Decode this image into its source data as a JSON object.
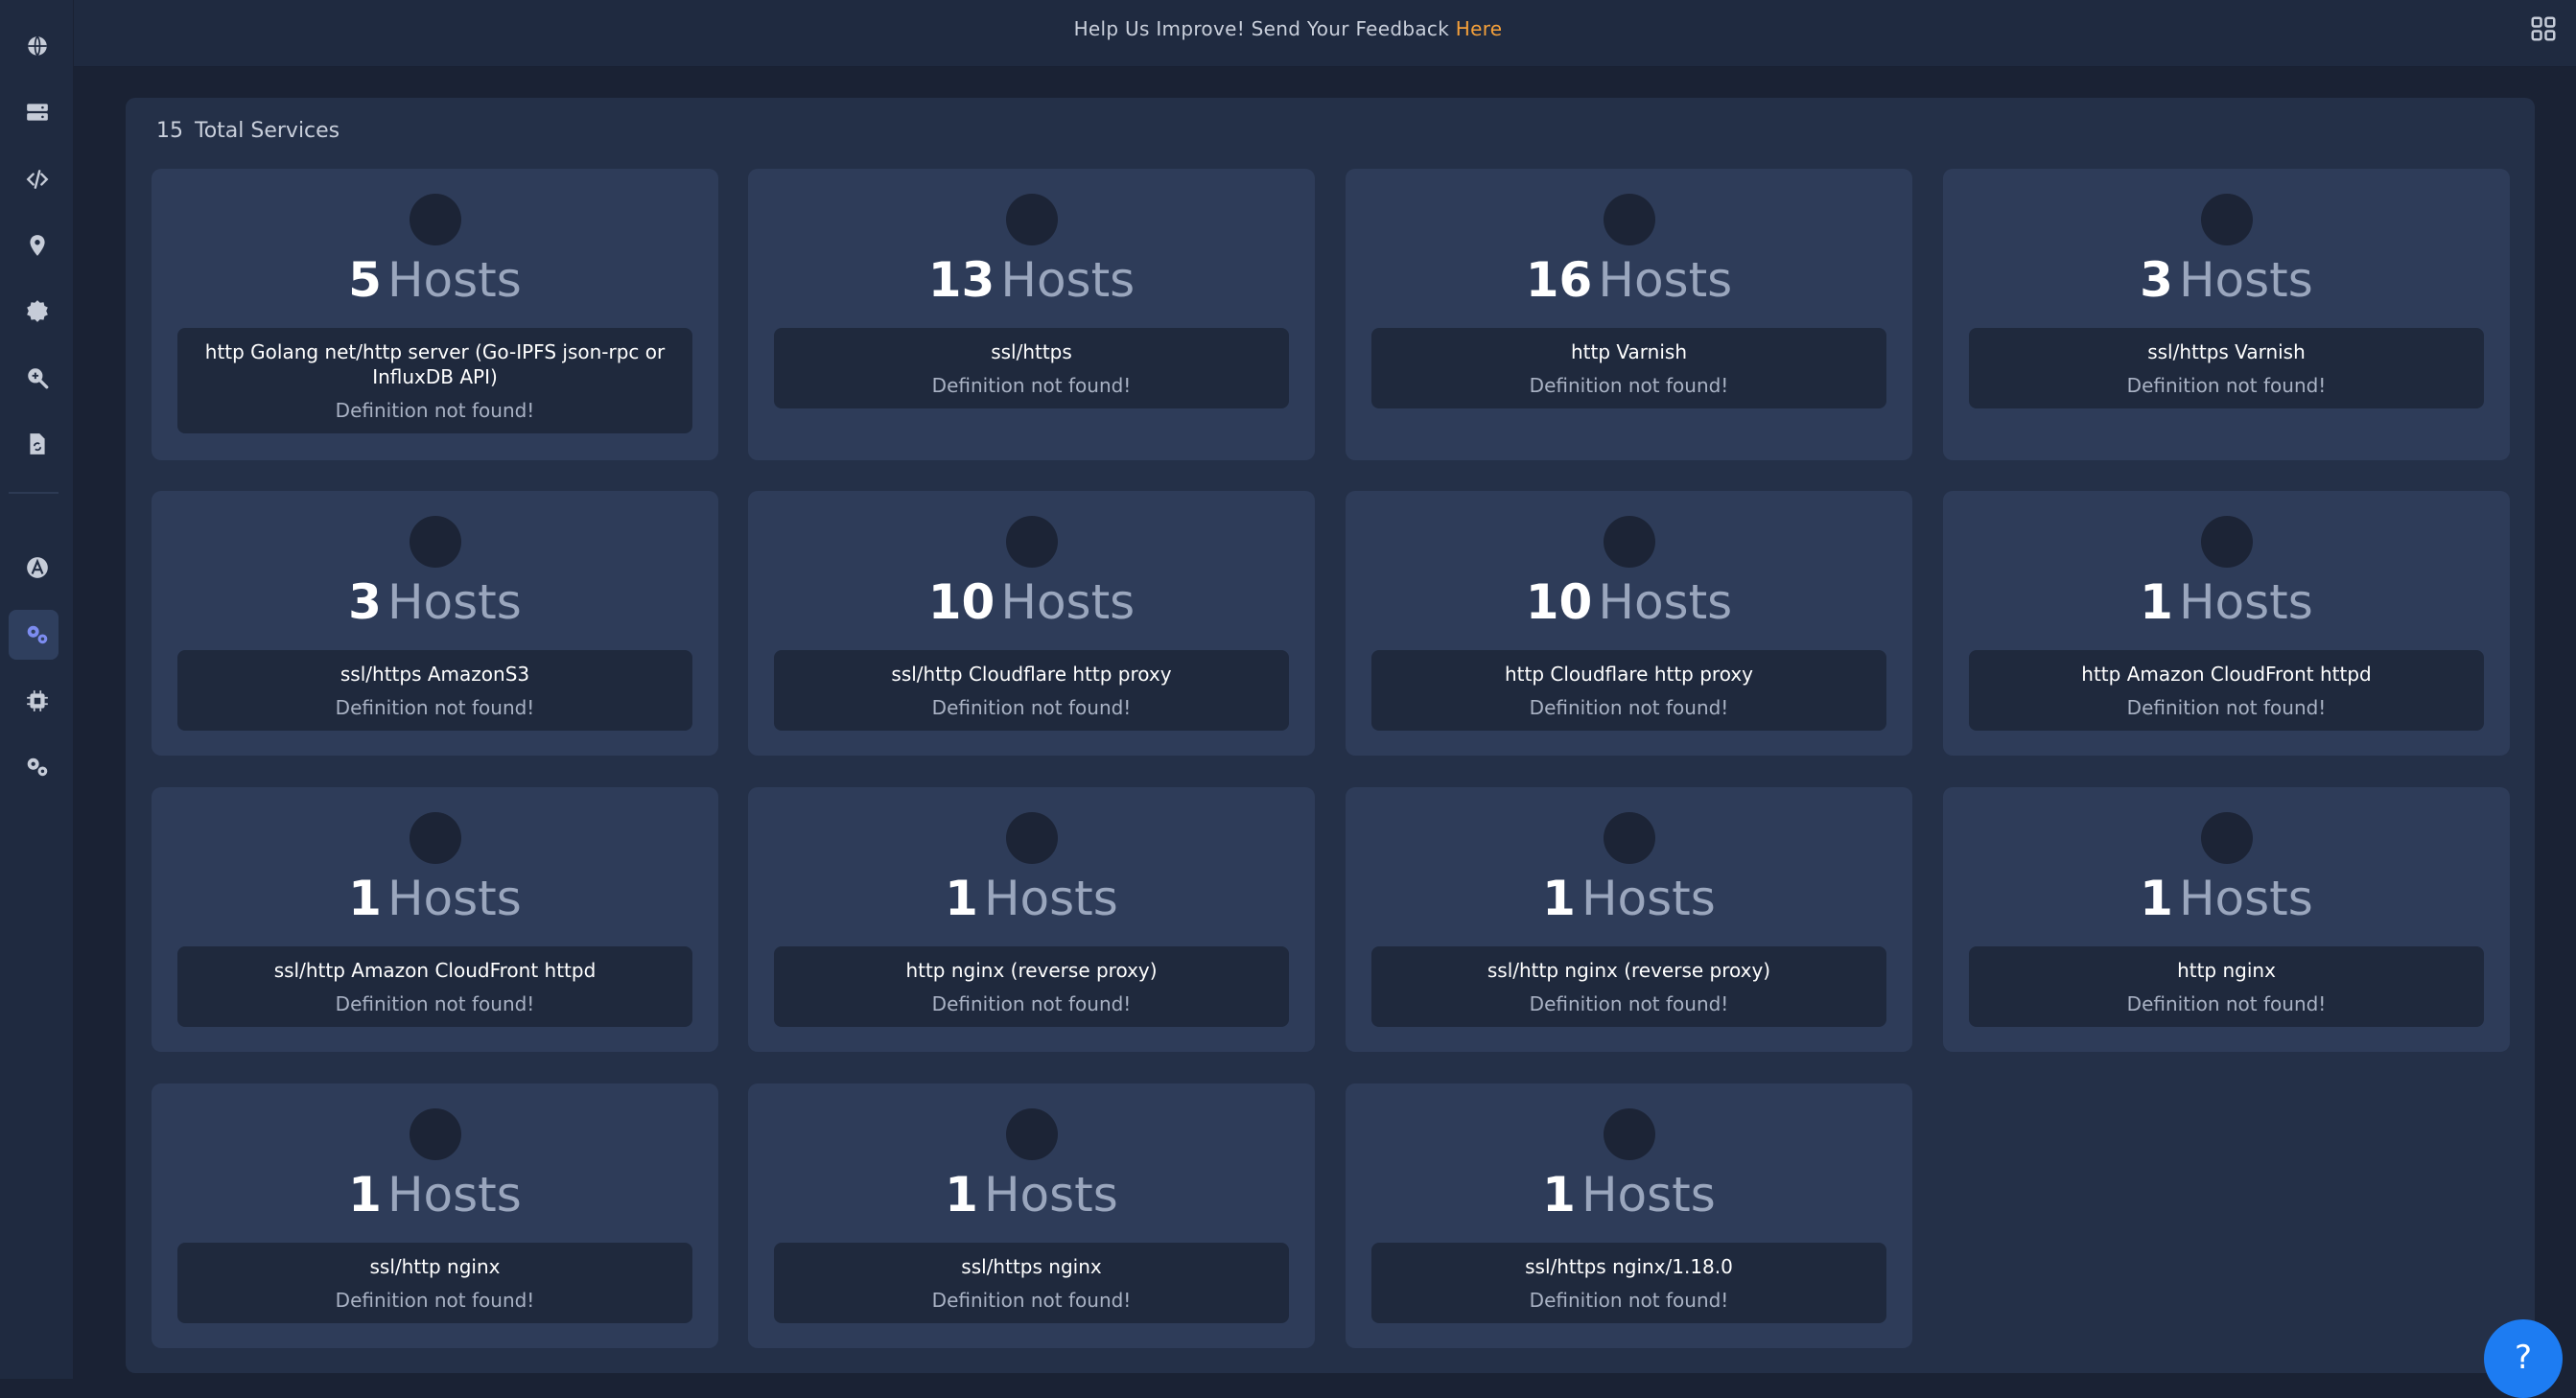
{
  "topbar": {
    "feedback_text": "Help Us Improve! Send Your Feedback ",
    "feedback_link": "Here",
    "notification_count": "0"
  },
  "sidebar": {
    "items": [
      {
        "icon": "globe-icon"
      },
      {
        "icon": "server-icon"
      },
      {
        "icon": "code-icon"
      },
      {
        "icon": "map-pin-icon"
      },
      {
        "icon": "gear-badge-icon"
      },
      {
        "icon": "search-plus-icon"
      },
      {
        "icon": "file-sync-icon"
      },
      {
        "icon": "anchor-a-icon"
      },
      {
        "icon": "cogs-icon",
        "active": true
      },
      {
        "icon": "chip-icon"
      },
      {
        "icon": "settings-cogs-icon"
      }
    ]
  },
  "summary": {
    "count": "15",
    "label": "Total Services"
  },
  "hosts_word": "Hosts",
  "services": [
    {
      "count": "5",
      "name": "http Golang net/http server (Go-IPFS json-rpc or InfluxDB API)",
      "definition": "Definition not found!"
    },
    {
      "count": "13",
      "name": "ssl/https",
      "definition": "Definition not found!"
    },
    {
      "count": "16",
      "name": "http Varnish",
      "definition": "Definition not found!"
    },
    {
      "count": "3",
      "name": "ssl/https Varnish",
      "definition": "Definition not found!"
    },
    {
      "count": "3",
      "name": "ssl/https AmazonS3",
      "definition": "Definition not found!"
    },
    {
      "count": "10",
      "name": "ssl/http Cloudflare http proxy",
      "definition": "Definition not found!"
    },
    {
      "count": "10",
      "name": "http Cloudflare http proxy",
      "definition": "Definition not found!"
    },
    {
      "count": "1",
      "name": "http Amazon CloudFront httpd",
      "definition": "Definition not found!"
    },
    {
      "count": "1",
      "name": "ssl/http Amazon CloudFront httpd",
      "definition": "Definition not found!"
    },
    {
      "count": "1",
      "name": "http nginx (reverse proxy)",
      "definition": "Definition not found!"
    },
    {
      "count": "1",
      "name": "ssl/http nginx (reverse proxy)",
      "definition": "Definition not found!"
    },
    {
      "count": "1",
      "name": "http nginx",
      "definition": "Definition not found!"
    },
    {
      "count": "1",
      "name": "ssl/http nginx",
      "definition": "Definition not found!"
    },
    {
      "count": "1",
      "name": "ssl/https nginx",
      "definition": "Definition not found!"
    },
    {
      "count": "1",
      "name": "ssl/https nginx/1.18.0",
      "definition": "Definition not found!"
    }
  ],
  "help_button_label": "?",
  "colors": {
    "accent_link": "#f5a03a",
    "help_button": "#1d7cf2",
    "active_icon": "#7c8cf0"
  }
}
